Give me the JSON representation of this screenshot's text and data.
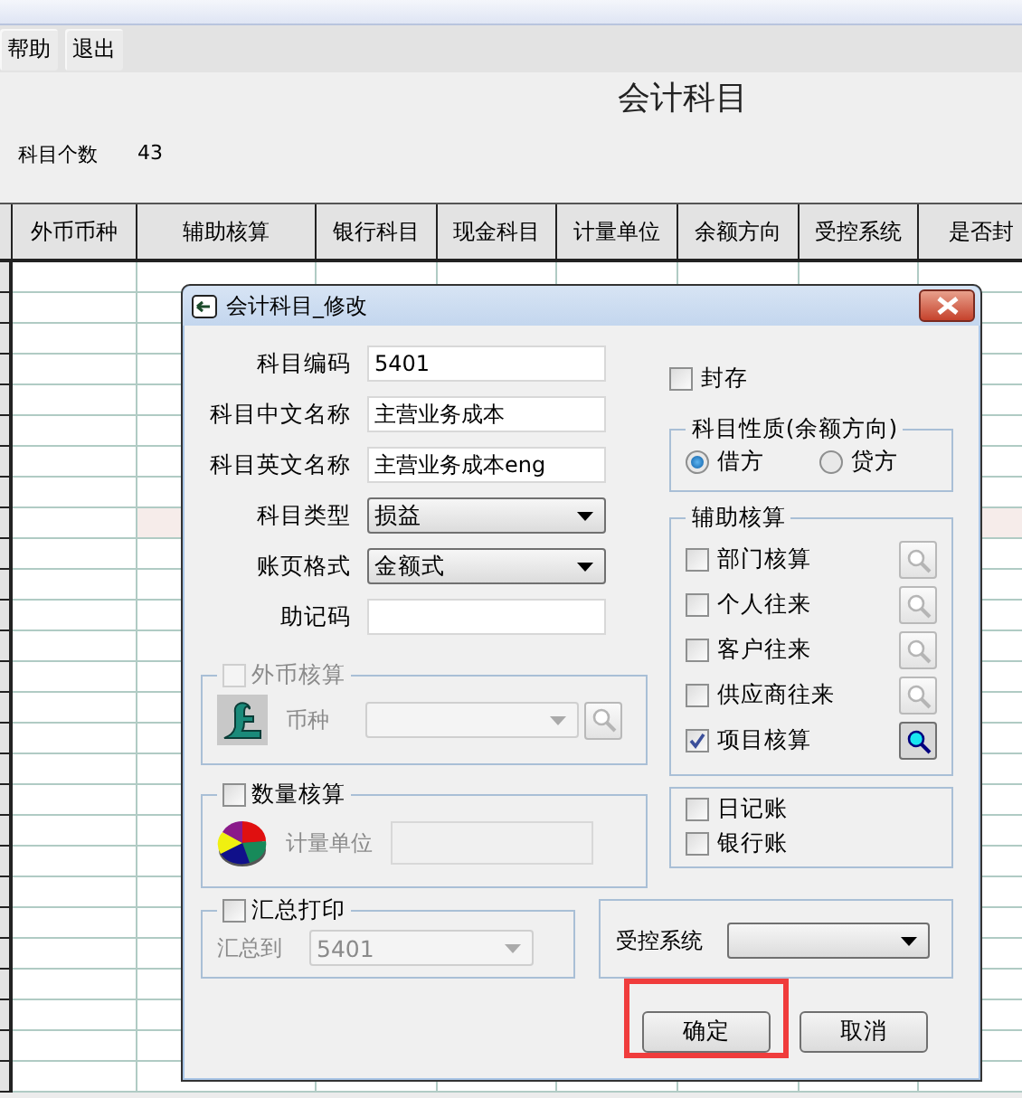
{
  "toolbar": [
    {
      "label": "帮助"
    },
    {
      "label": "退出"
    }
  ],
  "page_title": "会计科目",
  "count": {
    "label": "科目个数",
    "value": "43"
  },
  "table": {
    "columns": [
      "外币币种",
      "辅助核算",
      "银行科目",
      "现金科目",
      "计量单位",
      "余额方向",
      "受控系统",
      "是否封"
    ]
  },
  "dialog": {
    "title": "会计科目_修改",
    "fields": [
      {
        "label": "科目编码",
        "kind": "input",
        "value": "5401"
      },
      {
        "label": "科目中文名称",
        "kind": "input",
        "value": "主营业务成本"
      },
      {
        "label": "科目英文名称",
        "kind": "input",
        "value": "主营业务成本eng"
      },
      {
        "label": "科目类型",
        "kind": "select",
        "value": "损益"
      },
      {
        "label": "账页格式",
        "kind": "select",
        "value": "金额式"
      },
      {
        "label": "助记码",
        "kind": "input"
      }
    ],
    "sealed": {
      "label": "封存",
      "checked": false
    },
    "nature": {
      "title": "科目性质(余额方向)",
      "options": [
        {
          "label": "借方",
          "selected": true
        },
        {
          "label": "贷方",
          "selected": false
        }
      ]
    },
    "aux": {
      "title": "辅助核算",
      "items": [
        {
          "label": "部门核算",
          "checked": false
        },
        {
          "label": "个人往来",
          "checked": false
        },
        {
          "label": "客户往来",
          "checked": false
        },
        {
          "label": "供应商往来",
          "checked": false
        },
        {
          "label": "项目核算",
          "checked": true
        }
      ]
    },
    "journals": [
      {
        "label": "日记账",
        "checked": false
      },
      {
        "label": "银行账",
        "checked": false
      }
    ],
    "foreign": {
      "label": "外币核算",
      "checked": false,
      "disabled": true,
      "field_label": "币种",
      "field_disabled": true
    },
    "quantity": {
      "label": "数量核算",
      "checked": false,
      "field_label": "计量单位",
      "field_disabled": true
    },
    "summary": {
      "label": "汇总打印",
      "checked": false,
      "field_label": "汇总到",
      "value": "5401",
      "field_disabled": true
    },
    "controlled": {
      "label": "受控系统"
    },
    "buttons": [
      {
        "label": "确定",
        "highlighted": true
      },
      {
        "label": "取消",
        "highlighted": false
      }
    ]
  }
}
